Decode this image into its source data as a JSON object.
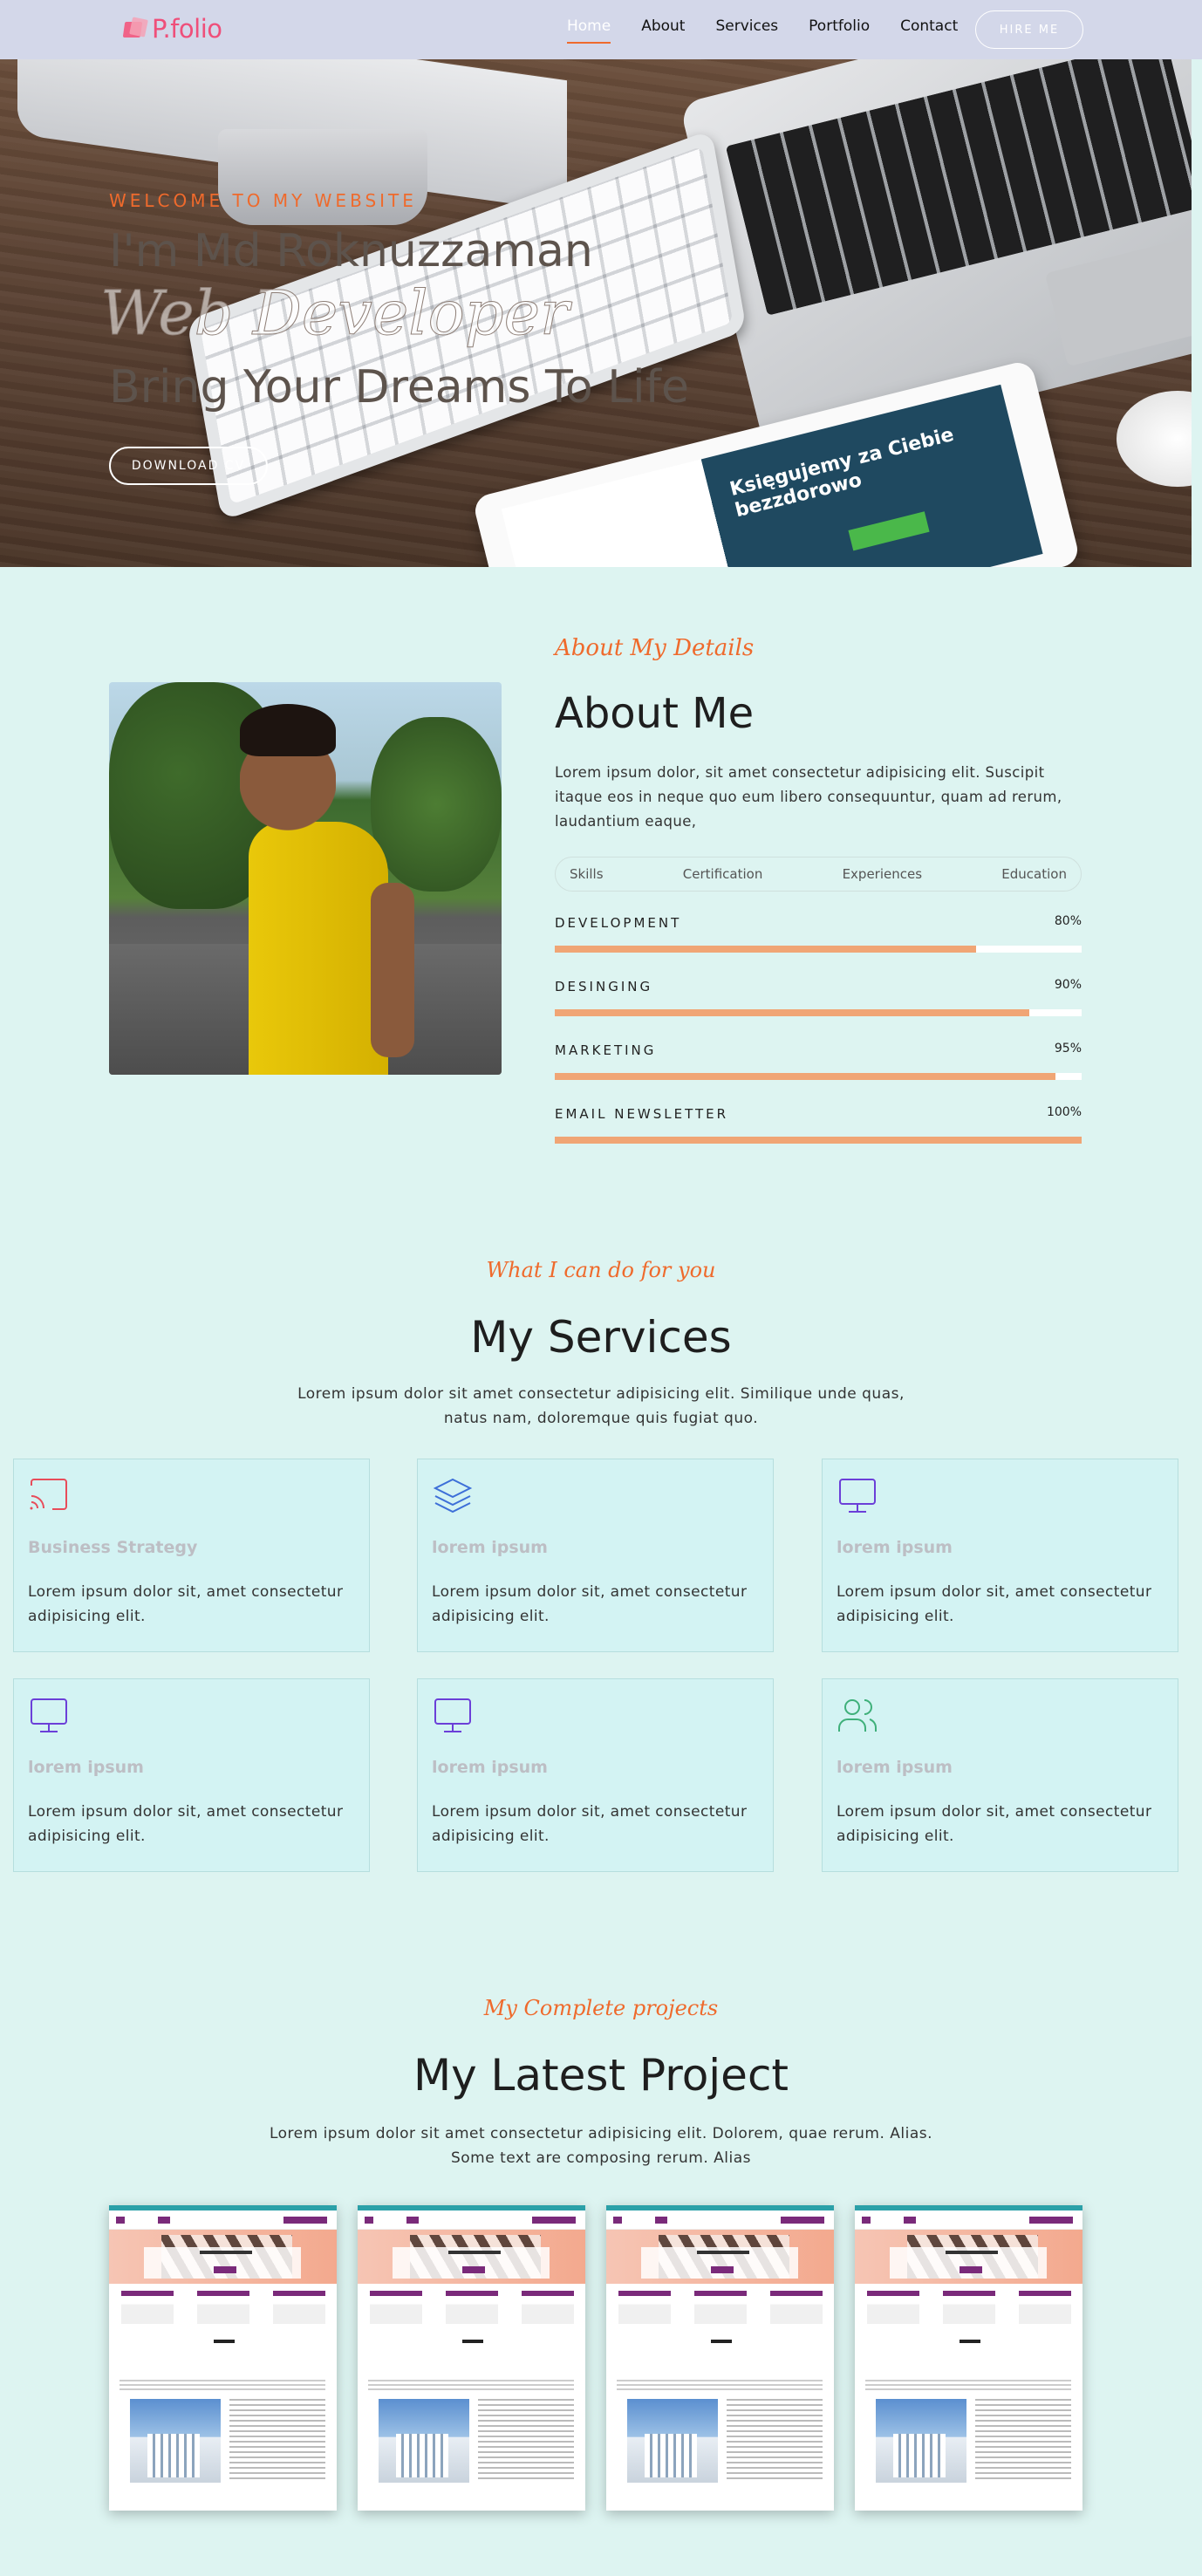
{
  "nav": {
    "logo": "P.folio",
    "items": [
      "Home",
      "About",
      "Services",
      "Portfolio",
      "Contact"
    ],
    "active": "Home",
    "hire_label": "HIRE ME"
  },
  "hero": {
    "welcome": "WELCOME TO MY WEBSITE",
    "name": "I'm Md Roknuzzaman",
    "role": "Web Developer",
    "tagline": "Bring Your Dreams To Life",
    "download_label": "DOWNLOAD CV",
    "tablet_heading": "Księgujemy za Ciebie bezzdorowo"
  },
  "about": {
    "subtitle": "About My Details",
    "title": "About Me",
    "text": "Lorem ipsum dolor, sit amet consectetur adipisicing elit. Suscipit itaque eos in neque quo eum libero consequuntur, quam ad rerum, laudantium eaque,",
    "tabs": [
      "Skills",
      "Certification",
      "Experiences",
      "Education"
    ],
    "skills": [
      {
        "label": "DEVELOPMENT",
        "percent_text": "80%",
        "value": 80
      },
      {
        "label": "DESINGING",
        "percent_text": "90%",
        "value": 90
      },
      {
        "label": "MARKETING",
        "percent_text": "95%",
        "value": 95
      },
      {
        "label": "EMAIL NEWSLETTER",
        "percent_text": "100%",
        "value": 100
      }
    ],
    "accent_color": "#f0a575"
  },
  "services": {
    "subtitle": "What I can do for you",
    "title": "My Services",
    "text_line1": "Lorem ipsum dolor sit amet consectetur adipisicing elit. Similique unde quas,",
    "text_line2": "natus nam, doloremque quis fugiat quo.",
    "cards": [
      {
        "icon": "cast-icon",
        "title": "Business Strategy",
        "text": "Lorem ipsum dolor sit, amet consectetur adipisicing elit."
      },
      {
        "icon": "layers-icon",
        "title": "lorem ipsum",
        "text": "Lorem ipsum dolor sit, amet consectetur adipisicing elit."
      },
      {
        "icon": "monitor-icon",
        "title": "lorem ipsum",
        "text": "Lorem ipsum dolor sit, amet consectetur adipisicing elit."
      },
      {
        "icon": "monitor-icon",
        "title": "lorem ipsum",
        "text": "Lorem ipsum dolor sit, amet consectetur adipisicing elit."
      },
      {
        "icon": "monitor-icon",
        "title": "lorem ipsum",
        "text": "Lorem ipsum dolor sit, amet consectetur adipisicing elit."
      },
      {
        "icon": "users-icon",
        "title": "lorem ipsum",
        "text": "Lorem ipsum dolor sit, amet consectetur adipisicing elit."
      }
    ]
  },
  "projects": {
    "subtitle": "My Complete projects",
    "title": "My Latest Project",
    "text_line1": "Lorem ipsum dolor sit amet consectetur adipisicing elit. Dolorem, quae rerum. Alias.",
    "text_line2": "Some text are composing rerum. Alias",
    "thumb_heading": "Welcome to Lifeleweider",
    "thumb_about": "ABOUT US"
  }
}
